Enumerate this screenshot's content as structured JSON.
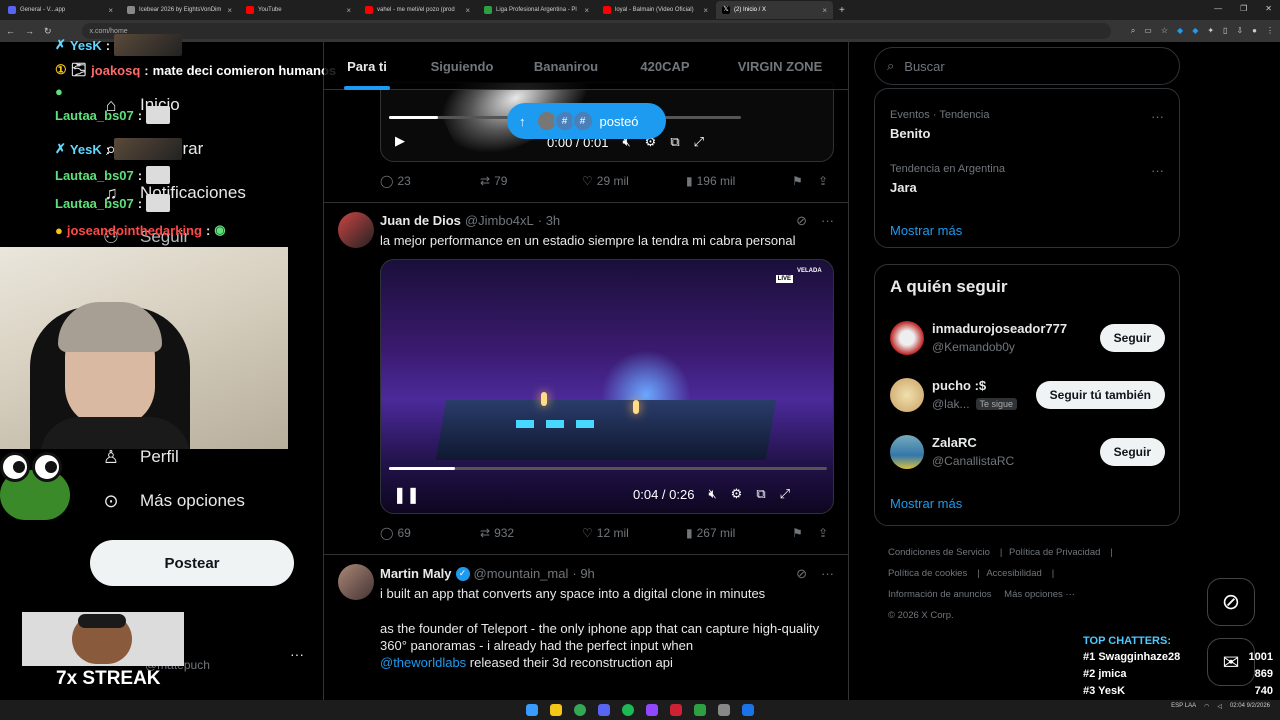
{
  "browser": {
    "tabs": [
      {
        "label": "General - V...app",
        "color": "#5865f2"
      },
      {
        "label": "Icebear 2026 by EightsVonDim",
        "color": "#888888"
      },
      {
        "label": "YouTube",
        "color": "#ff0000"
      },
      {
        "label": "vahel - me meti/el pozo (prod",
        "color": "#ff0000"
      },
      {
        "label": "Liga Profesional Argentina - Pl",
        "color": "#2ea043"
      },
      {
        "label": "loyal - Balmain (Video Oficial)",
        "color": "#ff0000"
      },
      {
        "label": "(2) Inicio / X",
        "color": "#ffffff"
      }
    ],
    "url": "x.com/home",
    "new_tab": "+"
  },
  "stream_chat": [
    {
      "user": "YesK",
      "msg": "",
      "color": "#62d8ff"
    },
    {
      "user": "joakosq",
      "msg": "mate deci comieron humanos",
      "color": "#ff6a6a"
    },
    {
      "user": "Lautaa_bs07",
      "msg": "",
      "color": "#5ee07a"
    },
    {
      "user": "YesK",
      "msg": "",
      "color": "#62d8ff"
    },
    {
      "user": "Lautaa_bs07",
      "msg": "",
      "color": "#5ee07a"
    },
    {
      "user": "Lautaa_bs07",
      "msg": "",
      "color": "#5ee07a"
    },
    {
      "user": "joseandointhedarking",
      "msg": "",
      "color": "#ff4848"
    }
  ],
  "left_nav": {
    "items": [
      {
        "label": "Inicio",
        "icon": "home-icon"
      },
      {
        "label": "Explorar",
        "icon": "search-icon"
      },
      {
        "label": "Notificaciones",
        "icon": "bell-icon"
      },
      {
        "label": "Seguir",
        "icon": "people-icon"
      },
      {
        "label": "Perfil",
        "icon": "person-icon"
      },
      {
        "label": "Más opciones",
        "icon": "more-circle-icon"
      }
    ],
    "post_button": "Postear",
    "account_handle": "@matepuch",
    "account_more": "···"
  },
  "timeline": {
    "tabs": [
      "Para ti",
      "Siguiendo",
      "Bananirou",
      "420CAP",
      "VIRGIN ZONE"
    ],
    "posted_pill": "posteó",
    "tweet1": {
      "time": "0:00 / 0:01",
      "replies": "23",
      "reposts": "79",
      "likes": "29 mil",
      "views": "196 mil"
    },
    "tweet2": {
      "name": "Juan de Dios",
      "handle": "@Jimbo4xL",
      "age": "· 3h",
      "text": "la mejor performance en un estadio siempre la tendra mi cabra personal",
      "video_time": "0:04 / 0:26",
      "video_progress": 0.15,
      "live_badge": "LIVE",
      "velada": "VELADA",
      "replies": "69",
      "reposts": "932",
      "likes": "12 mil",
      "views": "267 mil"
    },
    "tweet3": {
      "name": "Martin Maly",
      "handle": "@mountain_mal",
      "age": "· 9h",
      "line1": "i built an app that converts any space into a digital clone in minutes",
      "line2": "as the founder of Teleport - the only iphone app that can capture high-quality 360° panoramas - i already had the perfect input when",
      "mention": "@theworldlabs",
      "line3": " released their 3d reconstruction api"
    }
  },
  "sidebar": {
    "search_placeholder": "Buscar",
    "trends": [
      {
        "category": "Eventos · Tendencia",
        "name": "Benito"
      },
      {
        "category": "Tendencia en Argentina",
        "name": "Jara"
      }
    ],
    "trends_more": "Mostrar más",
    "who_to_follow_title": "A quién seguir",
    "follow": [
      {
        "name": "inmadurojoseador777",
        "handle": "@Kemandob0y",
        "button": "Seguir",
        "badge": ""
      },
      {
        "name": "pucho :$",
        "handle": "@lak...",
        "button": "Seguir tú también",
        "badge": "Te sigue"
      },
      {
        "name": "ZalaRC",
        "handle": "@CanallistaRC",
        "button": "Seguir",
        "badge": ""
      }
    ],
    "follow_more": "Mostrar más",
    "footer": {
      "terms": "Condiciones de Servicio",
      "privacy": "Política de Privacidad",
      "cookies": "Política de cookies",
      "accessibility": "Accesibilidad",
      "ads": "Información de anuncios",
      "more": "Más opciones ···",
      "copyright": "© 2026 X Corp."
    }
  },
  "overlay": {
    "streak": "7x STREAK",
    "top_chatters_title": "TOP CHATTERS:",
    "top_chatters": [
      {
        "rank": "#1",
        "name": "Swagginhaze28",
        "count": "1001"
      },
      {
        "rank": "#2",
        "name": "jmica",
        "count": "869"
      },
      {
        "rank": "#3",
        "name": "YesK",
        "count": "740"
      }
    ]
  },
  "taskbar": {
    "clock_time": "02:04",
    "clock_date": "9/2/2026",
    "lang": "ESP LAA"
  },
  "colors": {
    "accent": "#1d9bf0",
    "bg": "#000000",
    "border": "#2f3336"
  }
}
